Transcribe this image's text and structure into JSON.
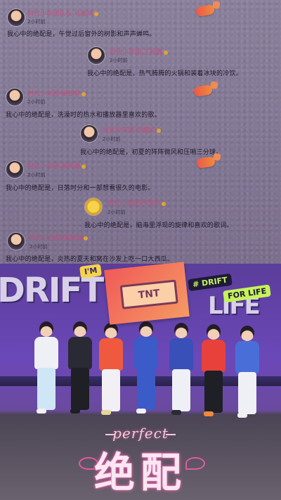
{
  "posts": [
    {
      "name": "时代少年团队长-马嘉祺",
      "time": "2小时前",
      "text": "我心中的绝配是，午觉过后窗外的树影和声声蝉鸣。"
    },
    {
      "name": "时代少年团-丁程鑫",
      "time": "2小时前",
      "text": "我心中的绝配是，热气腾腾的火锅和装着冰块的冷饮。"
    },
    {
      "name": "时代少年团-宋亚轩",
      "time": "2小时前",
      "text": "我心中的绝配是，洗澡时的热水和播放器里喜欢的歌。"
    },
    {
      "name": "时代少年团-刘耀文",
      "time": "2小时前",
      "text": "我心中的绝配是，初夏的阵阵微风和压哨三分球。"
    },
    {
      "name": "时代少年团-张真源",
      "time": "2小时前",
      "text": "我心中的绝配是，日落时分和一部想看很久的电影。"
    },
    {
      "name": "时代少年团-严浩翔",
      "time": "2小时前",
      "text": "我心中的绝配是，脑海里浮现的旋律和喜欢的歌词。"
    },
    {
      "name": "时代少年团-贺峻霖",
      "time": "2小时前",
      "text": "我心中的绝配是，炎热的夏天和窝在沙发上吃一口大西瓜。"
    }
  ],
  "photo": {
    "wall_text_left": "DRIFT",
    "wall_text_right": "LIFE",
    "tag_drift": "# DRIFT",
    "tag_forlife": "FOR LIFE",
    "tag_im": "I'M",
    "banner_text": "TNT",
    "perfect_label": "perfect",
    "title": "绝配"
  },
  "colors": {
    "name": "#c44b7a",
    "text": "#1f1a2a",
    "accent_pink": "#e05aa4"
  }
}
